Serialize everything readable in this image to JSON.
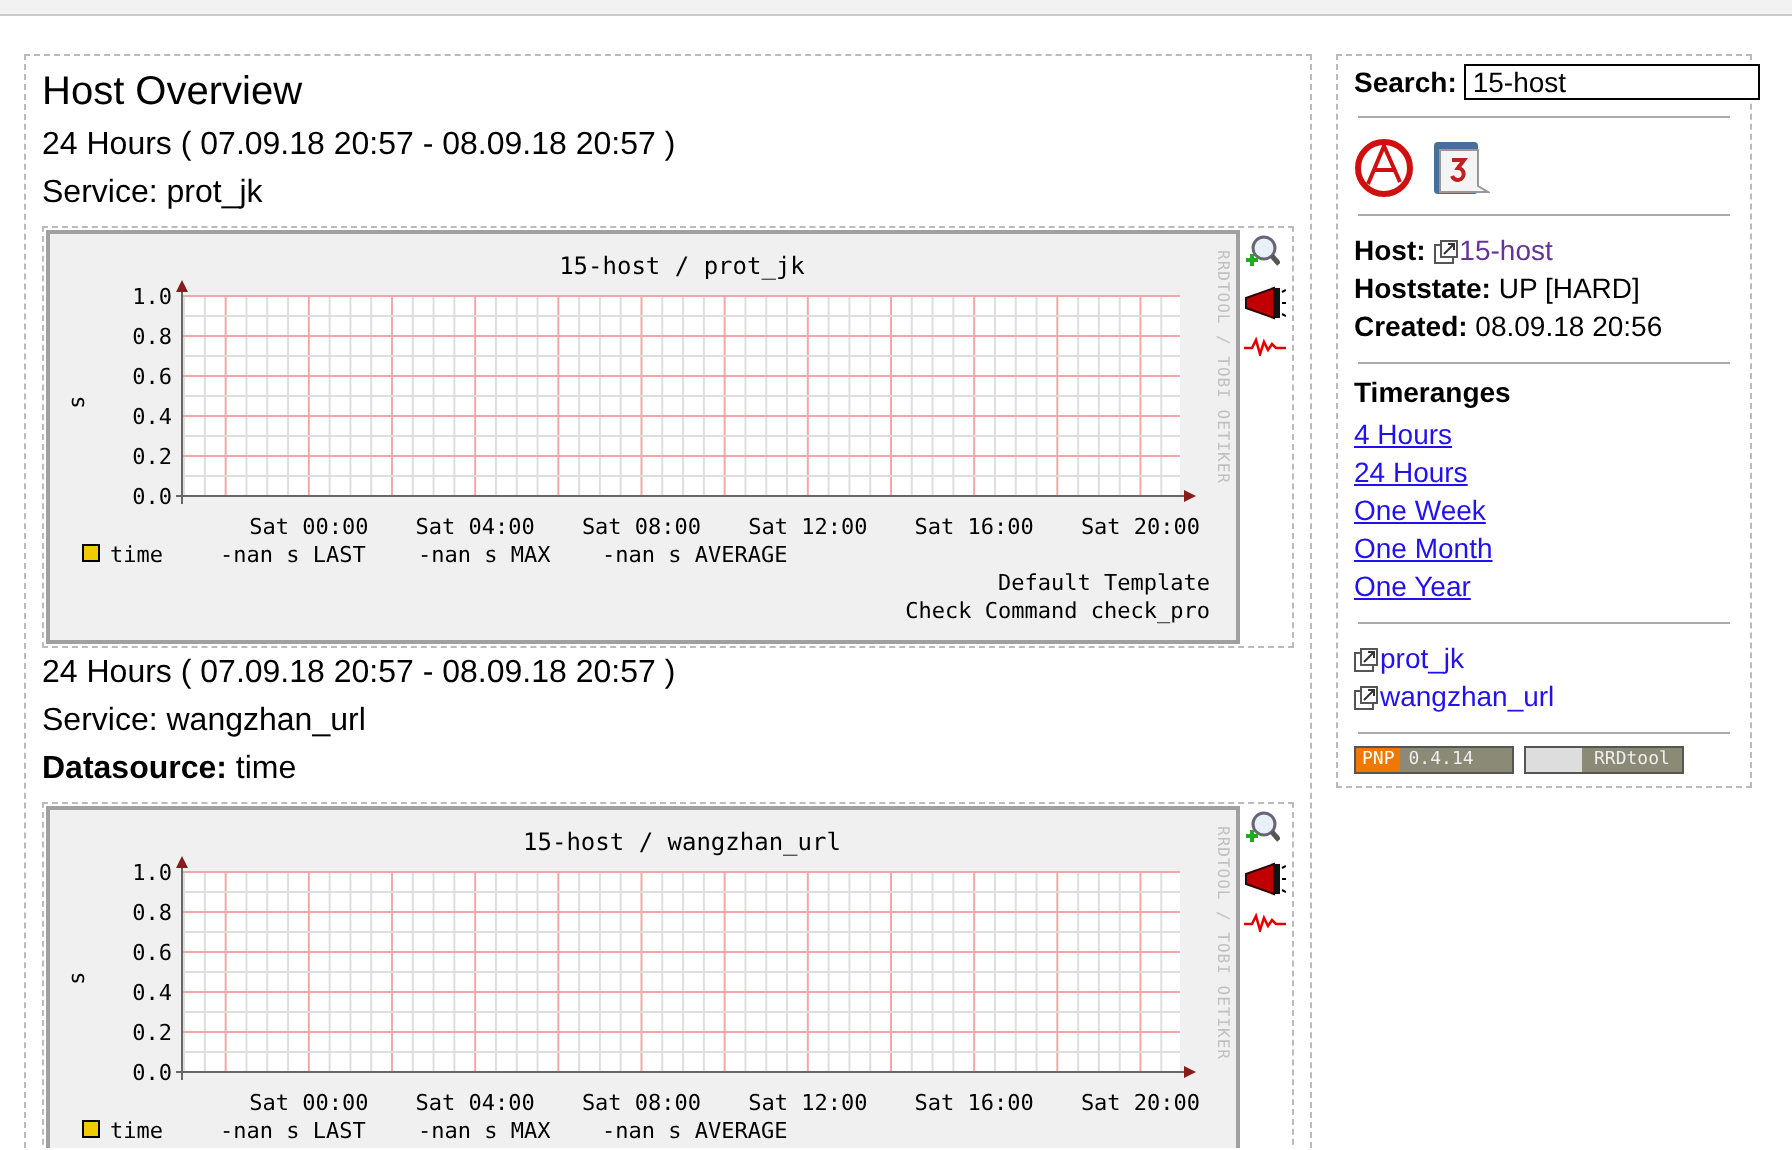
{
  "page": {
    "title": "Host Overview"
  },
  "sections": [
    {
      "timerange": "24 Hours ( 07.09.18 20:57 - 08.09.18 20:57 )",
      "service": "Service: prot_jk",
      "graph": {
        "title": "15-host / prot_jk",
        "ylabel": "s",
        "yticks": [
          "1.0",
          "0.8",
          "0.6",
          "0.4",
          "0.2",
          "0.0"
        ],
        "xticks": [
          "Sat 00:00",
          "Sat 04:00",
          "Sat 08:00",
          "Sat 12:00",
          "Sat 16:00",
          "Sat 20:00"
        ],
        "watermark": "RRDTOOL / TOBI OETIKER",
        "legend": {
          "name": "time",
          "color": "#eecc00",
          "stats": [
            "-nan s LAST",
            "-nan s MAX",
            "-nan s AVERAGE"
          ]
        },
        "footer": [
          "Default Template",
          "Check Command check_pro"
        ]
      }
    },
    {
      "timerange": "24 Hours ( 07.09.18 20:57 - 08.09.18 20:57 )",
      "service": "Service: wangzhan_url",
      "datasource": "**Datasource:** time",
      "graph": {
        "title": "15-host / wangzhan_url",
        "ylabel": "s",
        "yticks": [
          "1.0",
          "0.8",
          "0.6",
          "0.4",
          "0.2",
          "0.0"
        ],
        "xticks": [
          "Sat 00:00",
          "Sat 04:00",
          "Sat 08:00",
          "Sat 12:00",
          "Sat 16:00",
          "Sat 20:00"
        ],
        "watermark": "RRDTOOL / TOBI OETIKER",
        "legend": {
          "name": "time",
          "color": "#eecc00",
          "stats": [
            "-nan s LAST",
            "-nan s MAX",
            "-nan s AVERAGE"
          ]
        }
      }
    }
  ],
  "sidebar": {
    "search": {
      "label": "Search:",
      "value": "15-host"
    },
    "host": {
      "label": "Host:",
      "value": "15-host"
    },
    "hoststate": "**Hoststate:** UP [HARD]",
    "created": "**Created:** 08.09.18 20:56",
    "timeranges": {
      "title": "Timeranges",
      "items": [
        "4 Hours",
        "24 Hours",
        "One Week",
        "One Month",
        "One Year"
      ]
    },
    "services": [
      "prot_jk",
      "wangzhan_url"
    ],
    "badges": [
      {
        "kind": "pnp",
        "parts": [
          "PNP",
          "0.4.14"
        ]
      },
      {
        "kind": "rrd",
        "parts": [
          "RRDtool"
        ]
      }
    ]
  }
}
